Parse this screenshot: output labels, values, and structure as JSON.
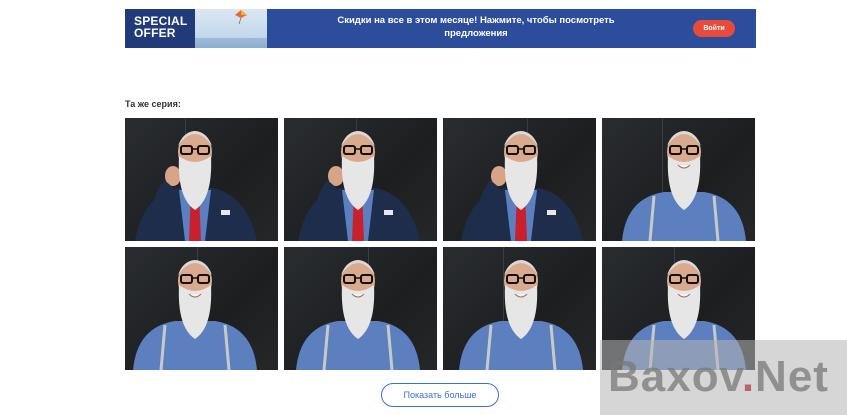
{
  "banner": {
    "badge": "SPECIAL\nOFFER",
    "text": "Скидки на все в этом месяце! Нажмите, чтобы посмотреть предложения",
    "button": "Войти"
  },
  "section": {
    "title": "Та же серия:"
  },
  "photos": [
    {
      "pose": "hand-on-mustache",
      "tie": true
    },
    {
      "pose": "hand-on-mustache",
      "tie": true
    },
    {
      "pose": "hand-on-mustache",
      "tie": true
    },
    {
      "pose": "smiling",
      "tie": false
    },
    {
      "pose": "smiling",
      "tie": false
    },
    {
      "pose": "smiling",
      "tie": false
    },
    {
      "pose": "smiling",
      "tie": false
    },
    {
      "pose": "smiling",
      "tie": false
    }
  ],
  "more_button": "Показать больше",
  "watermark": {
    "part1": "Baxov",
    "dot": ".",
    "part2": "Net"
  }
}
